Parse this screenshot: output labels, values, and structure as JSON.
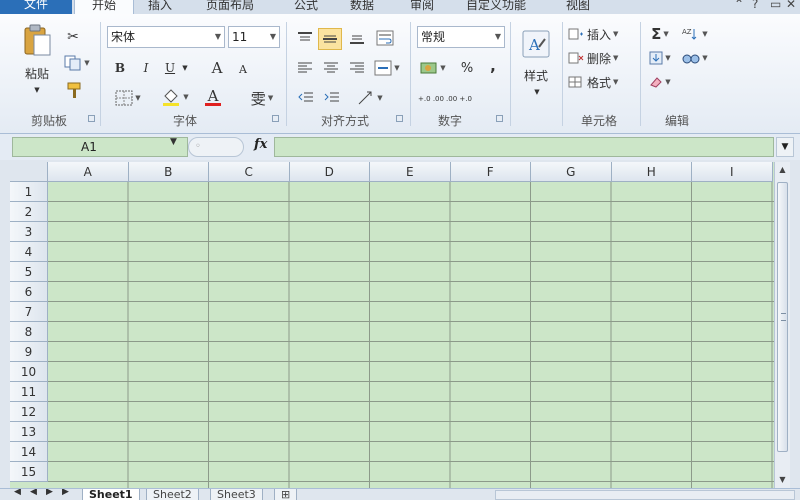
{
  "tabs": {
    "file": "文件",
    "home": "开始",
    "insert": "插入",
    "page_layout": "页面布局",
    "formulas": "公式",
    "data": "数据",
    "review": "审阅",
    "developer": "自定义功能",
    "view": "视图"
  },
  "ribbon": {
    "clipboard": {
      "label": "剪贴板",
      "paste": "粘贴"
    },
    "font": {
      "label": "字体",
      "font_name": "宋体",
      "font_size": "11",
      "bold": "B",
      "italic": "I",
      "underline": "U",
      "grow": "A",
      "shrink": "A",
      "color_a": "A",
      "phonetic": "雯"
    },
    "alignment": {
      "label": "对齐方式"
    },
    "number": {
      "label": "数字",
      "format": "常规",
      "percent": "%",
      "comma": ",",
      "inc_dec": "+.0 .00",
      "dec_dec": ".00 +.0"
    },
    "styles": {
      "label": "样式",
      "styles_btn": "样式"
    },
    "cells": {
      "label": "单元格",
      "insert": "插入",
      "delete": "删除",
      "format": "格式"
    },
    "editing": {
      "label": "编辑",
      "sum": "Σ"
    }
  },
  "formula_bar": {
    "name_box": "A1",
    "fx": "fx",
    "value": ""
  },
  "grid": {
    "columns": [
      "A",
      "B",
      "C",
      "D",
      "E",
      "F",
      "G",
      "H",
      "I"
    ],
    "rows": [
      "1",
      "2",
      "3",
      "4",
      "5",
      "6",
      "7",
      "8",
      "9",
      "10",
      "11",
      "12",
      "13",
      "14",
      "15"
    ]
  },
  "sheets": [
    "Sheet1",
    "Sheet2",
    "Sheet3"
  ],
  "colors": {
    "cell_fill": "#cce6c8",
    "file_tab": "#2b6fb8",
    "font_color_bar": "#e02020",
    "fill_color_bar": "#f5e22a"
  }
}
